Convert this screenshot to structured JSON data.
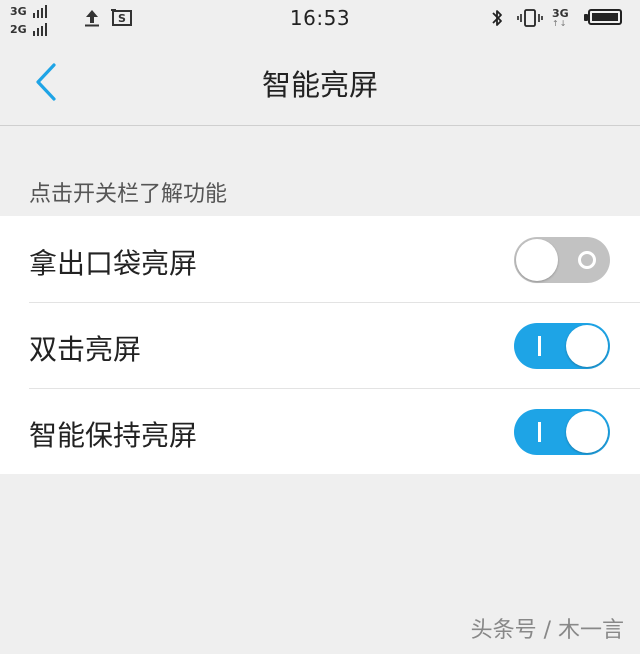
{
  "status_bar": {
    "sim1_network": "3G",
    "sim2_network": "2G",
    "time": "16:53",
    "data_network": "3G",
    "data_arrows": "↑↓",
    "icons": [
      "upload-icon",
      "screenshot-icon",
      "bluetooth-icon",
      "vibrate-icon",
      "battery-icon"
    ]
  },
  "nav": {
    "title": "智能亮屏",
    "back_icon": "chevron-left-icon"
  },
  "section": {
    "header": "点击开关栏了解功能"
  },
  "settings": [
    {
      "label": "拿出口袋亮屏",
      "enabled": false
    },
    {
      "label": "双击亮屏",
      "enabled": true
    },
    {
      "label": "智能保持亮屏",
      "enabled": true
    }
  ],
  "watermark": "头条号 / 木一言",
  "colors": {
    "accent": "#1ea4e6",
    "toggle_off": "#c2c2c2",
    "background": "#efefef",
    "list_background": "#ffffff"
  }
}
